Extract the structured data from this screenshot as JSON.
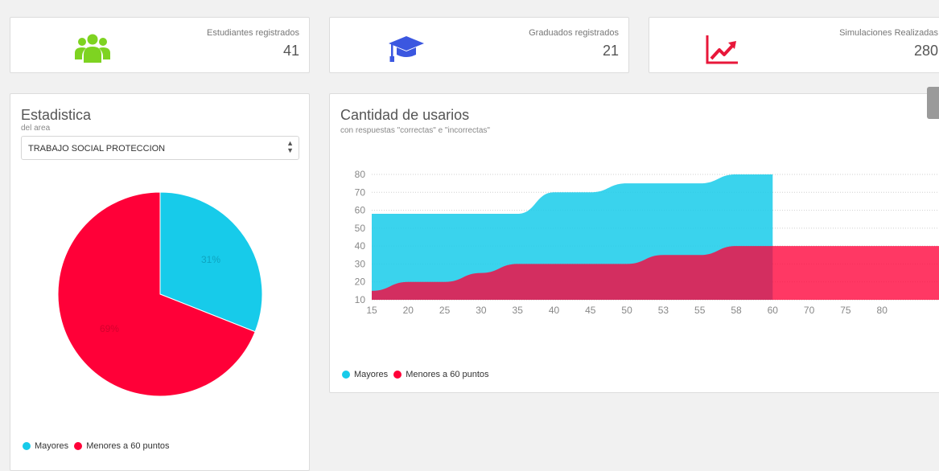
{
  "stats": [
    {
      "label": "Estudiantes registrados",
      "value": "41",
      "icon": "users-icon",
      "color": "#7ed321"
    },
    {
      "label": "Graduados registrados",
      "value": "21",
      "icon": "graduation-cap-icon",
      "color": "#3b57e0"
    },
    {
      "label": "Simulaciones Realizadas",
      "value": "280",
      "icon": "trending-up-icon",
      "color": "#e8173a"
    }
  ],
  "area_panel": {
    "title": "Estadistica",
    "subtitle": "del area",
    "select_value": "TRABAJO SOCIAL PROTECCION",
    "legend": [
      "Mayores",
      "Menores a 60 puntos"
    ]
  },
  "users_panel": {
    "title": "Cantidad de usarios",
    "subtitle": "con respuestas \"correctas\" e \"incorrectas\"",
    "legend": [
      "Mayores",
      "Menores a 60 puntos"
    ]
  },
  "colors": {
    "mayores": "#17cbea",
    "menores": "#ff0038"
  },
  "chart_data": [
    {
      "type": "pie",
      "labels": [
        "Mayores",
        "Menores a 60 puntos"
      ],
      "values": [
        31,
        69
      ],
      "data_labels": [
        "31%",
        "69%"
      ]
    },
    {
      "type": "area",
      "categories": [
        "15",
        "20",
        "25",
        "30",
        "35",
        "40",
        "45",
        "50",
        "53",
        "55",
        "58",
        "60",
        "70",
        "75",
        "80"
      ],
      "series": [
        {
          "name": "Mayores",
          "values": [
            58,
            58,
            58,
            58,
            58,
            70,
            70,
            75,
            75,
            75,
            80,
            80,
            null,
            null,
            null
          ]
        },
        {
          "name": "Menores a 60 puntos",
          "values": [
            15,
            20,
            20,
            25,
            30,
            30,
            30,
            30,
            35,
            35,
            40,
            40,
            40,
            40,
            40
          ]
        }
      ],
      "yticks": [
        "80",
        "70",
        "60",
        "50",
        "40",
        "30",
        "20",
        "10"
      ],
      "ylim": [
        10,
        80
      ],
      "grid": "horizontal dotted",
      "legend_position": "bottom-left"
    }
  ]
}
